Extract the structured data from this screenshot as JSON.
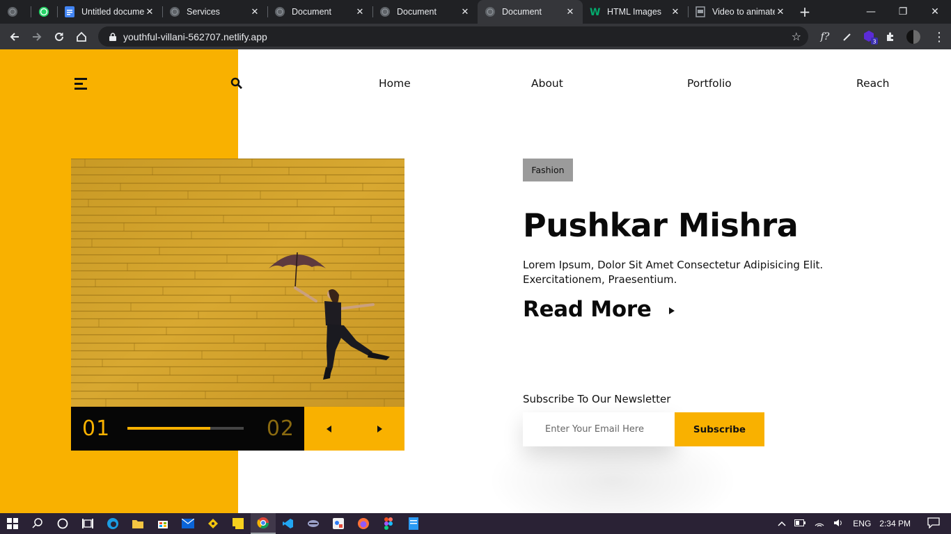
{
  "browser": {
    "tabs": [
      {
        "title": "",
        "icon": "globe-icon"
      },
      {
        "title": "",
        "icon": "whatsapp-icon"
      },
      {
        "title": "Untitled document",
        "icon": "docs-icon"
      },
      {
        "title": "Services",
        "icon": "globe-icon"
      },
      {
        "title": "Document",
        "icon": "globe-icon"
      },
      {
        "title": "Document",
        "icon": "globe-icon"
      },
      {
        "title": "Document",
        "icon": "globe-icon",
        "active": true
      },
      {
        "title": "HTML Images",
        "icon": "w3schools-icon"
      },
      {
        "title": "Video to animated",
        "icon": "page-icon"
      }
    ],
    "url": "youthful-villani-562707.netlify.app",
    "extension_badge": "3"
  },
  "site": {
    "nav": [
      "Home",
      "About",
      "Portfolio",
      "Reach"
    ],
    "tag": "Fashion",
    "heading": "Pushkar Mishra",
    "description": "Lorem Ipsum, Dolor Sit Amet Consectetur Adipisicing Elit. Exercitationem, Praesentium.",
    "read_more": "Read More",
    "slider": {
      "current": "01",
      "next": "02",
      "progress": 0.71
    },
    "newsletter": {
      "label": "Subscribe To Our Newsletter",
      "placeholder": "Enter Your Email Here",
      "button": "Subscribe"
    }
  },
  "colors": {
    "accent": "#f9b100",
    "dark": "#060606",
    "tag_bg": "#9b9b9b"
  },
  "taskbar": {
    "language": "ENG",
    "time": "2:34 PM"
  }
}
